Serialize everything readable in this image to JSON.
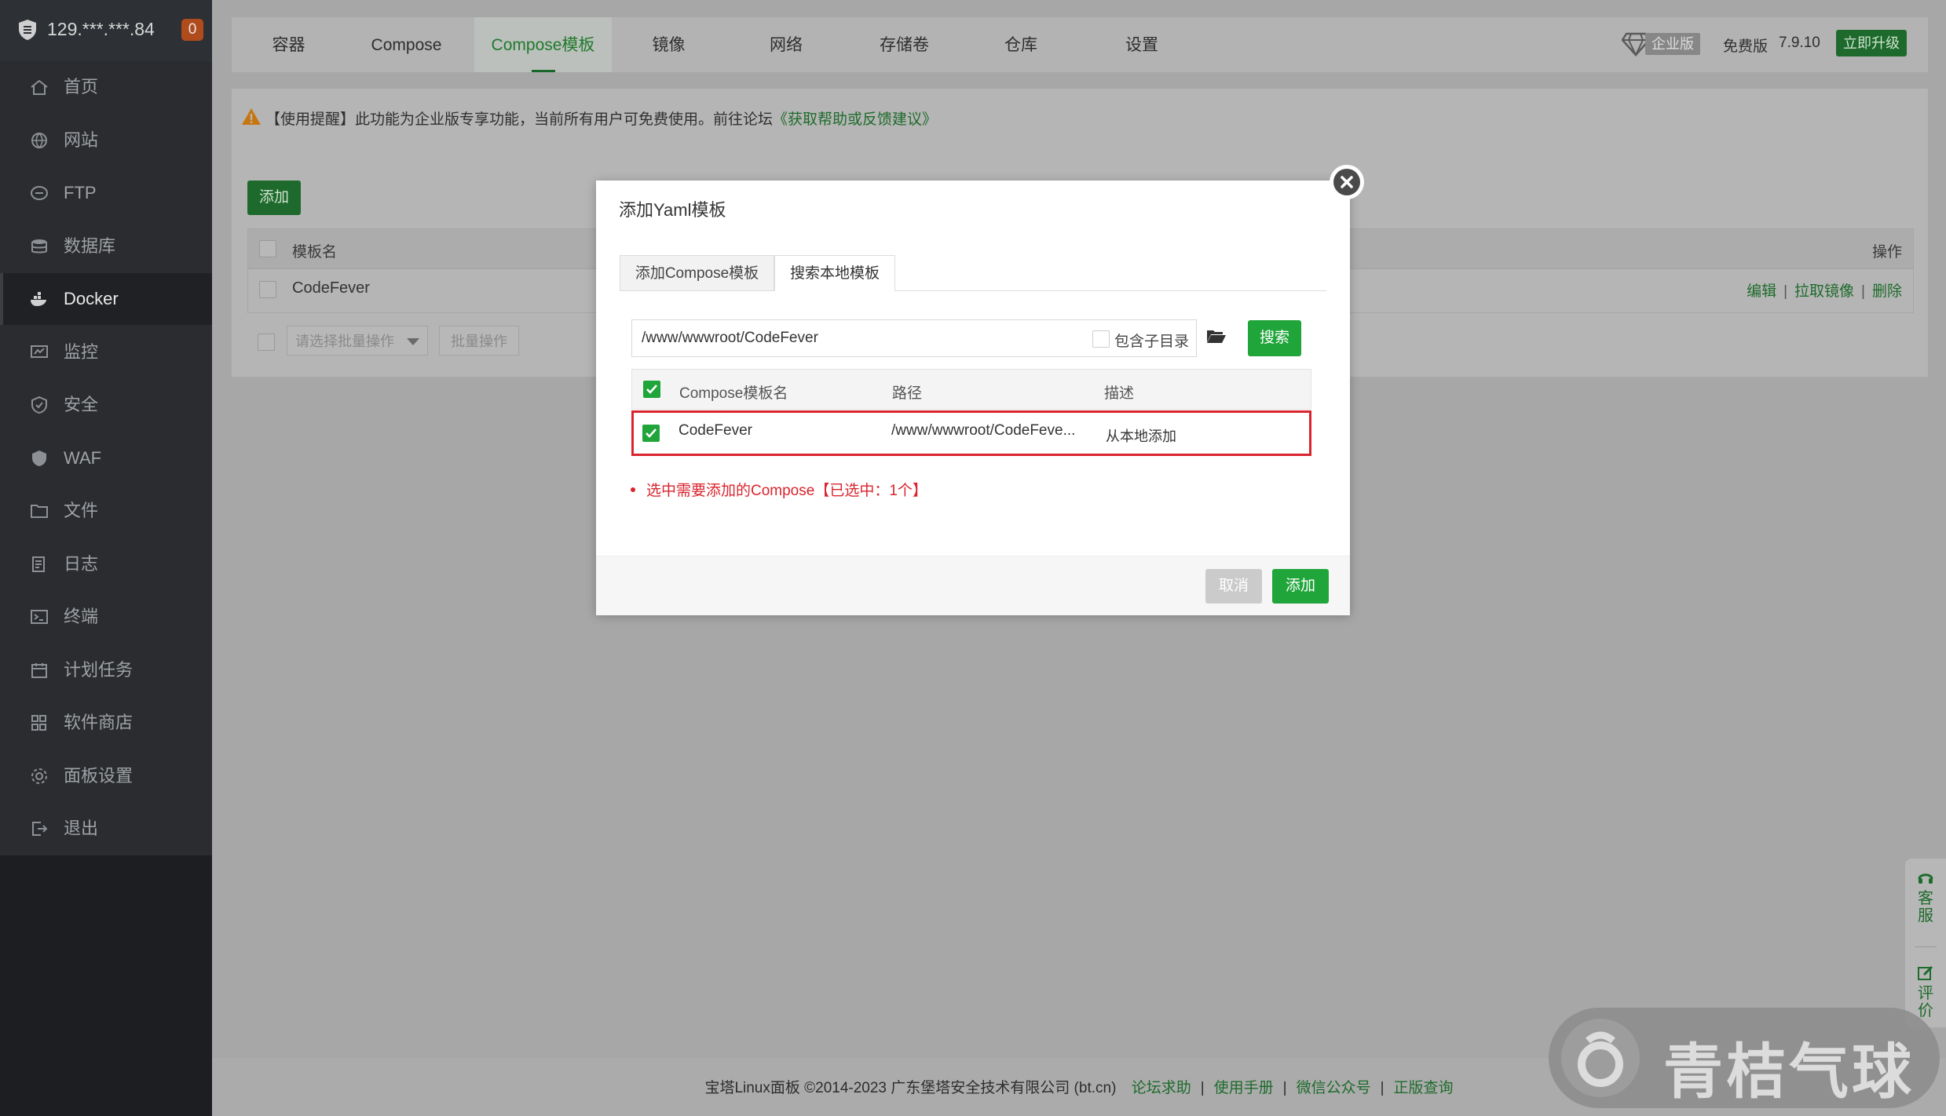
{
  "server": {
    "ip": "129.***.***.84",
    "badge": "0"
  },
  "sidebar": {
    "items": [
      {
        "label": "首页",
        "icon": "home-icon"
      },
      {
        "label": "网站",
        "icon": "globe-icon"
      },
      {
        "label": "FTP",
        "icon": "ftp-icon"
      },
      {
        "label": "数据库",
        "icon": "database-icon"
      },
      {
        "label": "Docker",
        "icon": "docker-icon",
        "active": true
      },
      {
        "label": "监控",
        "icon": "monitor-icon"
      },
      {
        "label": "安全",
        "icon": "shield-check-icon"
      },
      {
        "label": "WAF",
        "icon": "waf-shield-icon"
      },
      {
        "label": "文件",
        "icon": "folder-icon"
      },
      {
        "label": "日志",
        "icon": "log-icon"
      },
      {
        "label": "终端",
        "icon": "terminal-icon"
      },
      {
        "label": "计划任务",
        "icon": "calendar-icon"
      },
      {
        "label": "软件商店",
        "icon": "apps-icon"
      },
      {
        "label": "面板设置",
        "icon": "gear-icon"
      },
      {
        "label": "退出",
        "icon": "logout-icon"
      }
    ]
  },
  "topbar": {
    "tabs": [
      "容器",
      "Compose",
      "Compose模板",
      "镜像",
      "网络",
      "存储卷",
      "仓库",
      "设置"
    ],
    "active_tab": "Compose模板",
    "enterprise_label": "企业版",
    "free_label": "免费版",
    "version": "7.9.10",
    "upgrade_label": "立即升级"
  },
  "notice": {
    "text": "【使用提醒】此功能为企业版专享功能，当前所有用户可免费使用。前往论坛",
    "link": "《获取帮助或反馈建议》"
  },
  "panel": {
    "add_label": "添加",
    "col_name": "模板名",
    "col_ops": "操作",
    "rows": [
      {
        "name": "CodeFever",
        "ops": [
          "编辑",
          "拉取镜像",
          "删除"
        ]
      }
    ],
    "batch_placeholder": "请选择批量操作",
    "batch_button": "批量操作"
  },
  "modal": {
    "title": "添加Yaml模板",
    "tabs": [
      "添加Compose模板",
      "搜索本地模板"
    ],
    "active_tab": "搜索本地模板",
    "path_value": "/www/wwwroot/CodeFever",
    "include_subdir_label": "包含子目录",
    "search_label": "搜索",
    "columns": [
      "Compose模板名",
      "路径",
      "描述"
    ],
    "rows": [
      {
        "name": "CodeFever",
        "path": "/www/wwwroot/CodeFeve...",
        "desc": "从本地添加",
        "checked": true
      }
    ],
    "hint": "选中需要添加的Compose【已选中：1个】",
    "cancel_label": "取消",
    "confirm_label": "添加"
  },
  "footer": {
    "copyright": "宝塔Linux面板 ©2014-2023 广东堡塔安全技术有限公司 (bt.cn)",
    "links": [
      "论坛求助",
      "使用手册",
      "微信公众号",
      "正版查询"
    ]
  },
  "float": {
    "service": "客服",
    "review": "评价"
  },
  "watermark": {
    "text": "青桔气球"
  },
  "colors": {
    "accent": "#20a53a",
    "danger": "#d9242e",
    "sidebar": "#2a2c2f"
  }
}
